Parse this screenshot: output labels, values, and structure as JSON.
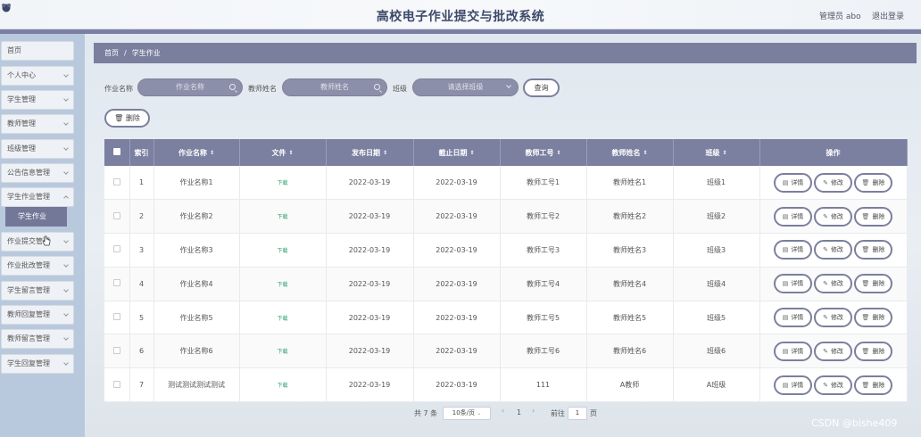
{
  "header": {
    "title": "高校电子作业提交与批改系统",
    "admin": "管理员 abo",
    "logout": "退出登录"
  },
  "sidebar": {
    "items": [
      {
        "label": "首页",
        "chevron": false
      },
      {
        "label": "个人中心",
        "chevron": true
      },
      {
        "label": "学生管理",
        "chevron": true
      },
      {
        "label": "教师管理",
        "chevron": true
      },
      {
        "label": "班级管理",
        "chevron": true
      },
      {
        "label": "公告信息管理",
        "chevron": true
      },
      {
        "label": "学生作业管理",
        "chevron": true
      },
      {
        "label": "作业提交管理",
        "chevron": true
      },
      {
        "label": "作业批改管理",
        "chevron": true
      },
      {
        "label": "学生留言管理",
        "chevron": true
      },
      {
        "label": "教师回复管理",
        "chevron": true
      },
      {
        "label": "教师留言管理",
        "chevron": true
      },
      {
        "label": "学生回复管理",
        "chevron": true
      }
    ],
    "active_sub": "学生作业"
  },
  "breadcrumb": {
    "home": "首页",
    "sep": "/",
    "current": "学生作业"
  },
  "filters": {
    "homework_label": "作业名称",
    "homework_placeholder": "作业名称",
    "teacher_label": "教师姓名",
    "teacher_placeholder": "教师姓名",
    "class_label": "班级",
    "class_placeholder": "请选择班级",
    "query": "查询"
  },
  "delete_button": "删除",
  "table": {
    "headers": {
      "index": "索引",
      "name": "作业名称",
      "file": "文件",
      "publish": "发布日期",
      "deadline": "截止日期",
      "teacher_id": "教师工号",
      "teacher_name": "教师姓名",
      "class": "班级",
      "ops": "操作"
    },
    "sort_glyph": "⇕",
    "rows": [
      {
        "index": "1",
        "name": "作业名称1",
        "file": "下载",
        "publish": "2022-03-19",
        "deadline": "2022-03-19",
        "teacher_id": "教师工号1",
        "teacher_name": "教师姓名1",
        "class": "班级1"
      },
      {
        "index": "2",
        "name": "作业名称2",
        "file": "下载",
        "publish": "2022-03-19",
        "deadline": "2022-03-19",
        "teacher_id": "教师工号2",
        "teacher_name": "教师姓名2",
        "class": "班级2"
      },
      {
        "index": "3",
        "name": "作业名称3",
        "file": "下载",
        "publish": "2022-03-19",
        "deadline": "2022-03-19",
        "teacher_id": "教师工号3",
        "teacher_name": "教师姓名3",
        "class": "班级3"
      },
      {
        "index": "4",
        "name": "作业名称4",
        "file": "下载",
        "publish": "2022-03-19",
        "deadline": "2022-03-19",
        "teacher_id": "教师工号4",
        "teacher_name": "教师姓名4",
        "class": "班级4"
      },
      {
        "index": "5",
        "name": "作业名称5",
        "file": "下载",
        "publish": "2022-03-19",
        "deadline": "2022-03-19",
        "teacher_id": "教师工号5",
        "teacher_name": "教师姓名5",
        "class": "班级5"
      },
      {
        "index": "6",
        "name": "作业名称6",
        "file": "下载",
        "publish": "2022-03-19",
        "deadline": "2022-03-19",
        "teacher_id": "教师工号6",
        "teacher_name": "教师姓名6",
        "class": "班级6"
      },
      {
        "index": "7",
        "name": "测试测试测试测试",
        "file": "下载",
        "publish": "2022-03-19",
        "deadline": "2022-03-19",
        "teacher_id": "111",
        "teacher_name": "A教师",
        "class": "A班级"
      }
    ],
    "actions": {
      "detail": "详情",
      "edit": "修改",
      "delete": "删除"
    }
  },
  "pagination": {
    "total": "共 7 条",
    "page_size": "10条/页",
    "prev": "‹",
    "page": "1",
    "next": "›",
    "goto_label": "前往",
    "goto_value": "1",
    "page_suffix": "页"
  },
  "watermark": "CSDN @bishe409",
  "colors": {
    "accent": "#7b7fa0",
    "sidebar": "#b9c9dd",
    "download": "#2aa06a"
  }
}
